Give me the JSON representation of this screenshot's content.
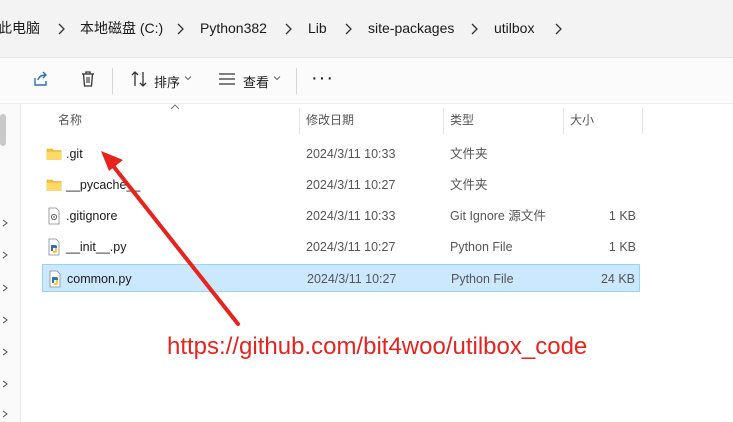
{
  "breadcrumbs": [
    "此电脑",
    "本地磁盘 (C:)",
    "Python382",
    "Lib",
    "site-packages",
    "utilbox"
  ],
  "toolbar": {
    "sort_label": "排序",
    "view_label": "查看",
    "more_label": "···"
  },
  "columns": {
    "name": "名称",
    "date": "修改日期",
    "type": "类型",
    "size": "大小"
  },
  "rows": [
    {
      "name": ".git",
      "date": "2024/3/11 10:33",
      "type": "文件夹",
      "size": "",
      "icon": "folder-icon"
    },
    {
      "name": "__pycache__",
      "date": "2024/3/11 10:27",
      "type": "文件夹",
      "size": "",
      "icon": "folder-icon"
    },
    {
      "name": ".gitignore",
      "date": "2024/3/11 10:33",
      "type": "Git Ignore 源文件",
      "size": "1 KB",
      "icon": "gitignore-file-icon"
    },
    {
      "name": "__init__.py",
      "date": "2024/3/11 10:27",
      "type": "Python File",
      "size": "1 KB",
      "icon": "python-file-icon"
    },
    {
      "name": "common.py",
      "date": "2024/3/11 10:27",
      "type": "Python File",
      "size": "24 KB",
      "icon": "python-file-icon",
      "selected": true
    }
  ],
  "annotation": {
    "text": "https://github.com/bit4woo/utilbox_code",
    "color": "#e8231e"
  }
}
